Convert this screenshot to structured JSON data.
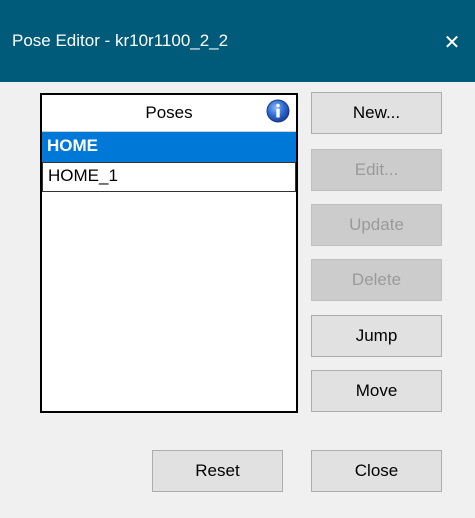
{
  "window": {
    "title": "Pose Editor - kr10r1100_2_2",
    "close_glyph": "✕",
    "title_bar_color": "#005a7a"
  },
  "poses_list": {
    "header": "Poses",
    "info_icon": "info-icon",
    "items": [
      {
        "label": "HOME",
        "selected": true
      },
      {
        "label": "HOME_1",
        "selected": false
      }
    ],
    "selection_color": "#0078d7"
  },
  "buttons": {
    "new": "New...",
    "edit": "Edit...",
    "update": "Update",
    "delete": "Delete",
    "jump": "Jump",
    "move": "Move",
    "reset": "Reset",
    "close": "Close"
  }
}
